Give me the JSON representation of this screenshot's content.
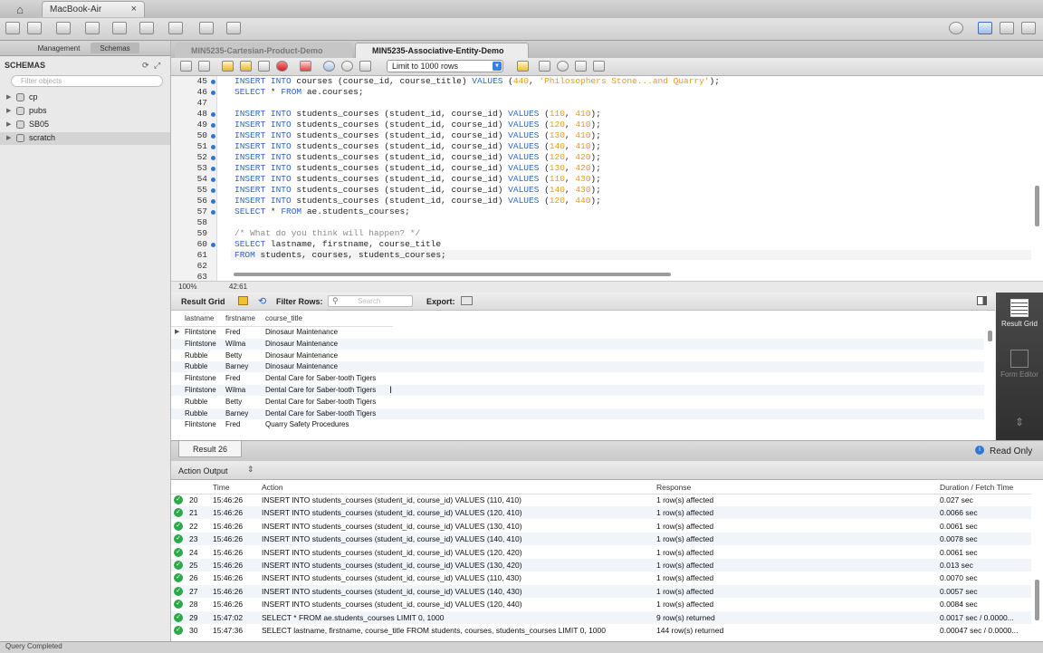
{
  "window": {
    "connection_tab": "MacBook-Air",
    "close_glyph": "×"
  },
  "sidebar": {
    "tabs": [
      "Management",
      "Schemas"
    ],
    "header": "SCHEMAS",
    "filter_placeholder": "Filter objects",
    "schemas": [
      "cp",
      "pubs",
      "SB05",
      "scratch"
    ]
  },
  "doc_tabs": [
    {
      "label": "MIN5235-Cartesian-Product-Demo",
      "active": false
    },
    {
      "label": "MIN5235-Associative-Entity-Demo",
      "active": true
    }
  ],
  "editor_toolbar": {
    "limit": "Limit to 1000 rows"
  },
  "editor": {
    "lines": [
      {
        "n": "45",
        "dot": true
      },
      {
        "n": "46",
        "dot": true
      },
      {
        "n": "47",
        "dot": false
      },
      {
        "n": "48",
        "dot": true
      },
      {
        "n": "49",
        "dot": true
      },
      {
        "n": "50",
        "dot": true
      },
      {
        "n": "51",
        "dot": true
      },
      {
        "n": "52",
        "dot": true
      },
      {
        "n": "53",
        "dot": true
      },
      {
        "n": "54",
        "dot": true
      },
      {
        "n": "55",
        "dot": true
      },
      {
        "n": "56",
        "dot": true
      },
      {
        "n": "57",
        "dot": true
      },
      {
        "n": "58",
        "dot": false
      },
      {
        "n": "59",
        "dot": false
      },
      {
        "n": "60",
        "dot": true
      },
      {
        "n": "61",
        "dot": false
      },
      {
        "n": "62",
        "dot": false
      },
      {
        "n": "63",
        "dot": false
      }
    ],
    "code": {
      "l45_a": "INSERT INTO",
      "l45_b": " courses (course_id, course_title) ",
      "l45_c": "VALUES",
      "l45_d": " (",
      "l45_e": "440",
      "l45_f": ", ",
      "l45_g": "'Philosophers Stone...and Quarry'",
      "l45_h": ");",
      "l46_a": "SELECT",
      "l46_b": " * ",
      "l46_c": "FROM",
      "l46_d": " ae.courses;",
      "ins_kw": "INSERT INTO",
      "ins_mid": " students_courses (student_id, course_id) ",
      "ins_vals": "VALUES",
      "inserts": [
        [
          "110",
          "410"
        ],
        [
          "120",
          "410"
        ],
        [
          "130",
          "410"
        ],
        [
          "140",
          "410"
        ],
        [
          "120",
          "420"
        ],
        [
          "130",
          "420"
        ],
        [
          "110",
          "430"
        ],
        [
          "140",
          "430"
        ],
        [
          "120",
          "440"
        ]
      ],
      "l57_a": "SELECT",
      "l57_b": " * ",
      "l57_c": "FROM",
      "l57_d": " ae.students_courses;",
      "l59": "/* What do you think will happen? */",
      "l60_a": "SELECT",
      "l60_b": " lastname, firstname, course_title",
      "l61_a": "FROM",
      "l61_b": " students, courses, students_courses;"
    },
    "status": {
      "zoom": "100%",
      "cursor": "42:61"
    }
  },
  "result_toolbar": {
    "result_grid": "Result Grid",
    "filter_rows": "Filter Rows:",
    "search_placeholder": "Search",
    "export": "Export:"
  },
  "result_grid": {
    "columns": [
      "lastname",
      "firstname",
      "course_title"
    ],
    "rows": [
      [
        "Flintstone",
        "Fred",
        "Dinosaur Maintenance"
      ],
      [
        "Flintstone",
        "Wilma",
        "Dinosaur Maintenance"
      ],
      [
        "Rubble",
        "Betty",
        "Dinosaur Maintenance"
      ],
      [
        "Rubble",
        "Barney",
        "Dinosaur Maintenance"
      ],
      [
        "Flintstone",
        "Fred",
        "Dental Care for Saber-tooth Tigers"
      ],
      [
        "Flintstone",
        "Wilma",
        "Dental Care for Saber-tooth Tigers"
      ],
      [
        "Rubble",
        "Betty",
        "Dental Care for Saber-tooth Tigers"
      ],
      [
        "Rubble",
        "Barney",
        "Dental Care for Saber-tooth Tigers"
      ],
      [
        "Flintstone",
        "Fred",
        "Quarry Safety Procedures"
      ]
    ]
  },
  "result_side": {
    "result_grid": "Result Grid",
    "form_editor": "Form Editor"
  },
  "result_footer": {
    "tab": "Result 26",
    "read_only": "Read Only"
  },
  "action_output": {
    "title": "Action Output",
    "columns": [
      "Time",
      "Action",
      "Response",
      "Duration / Fetch Time"
    ],
    "rows": [
      [
        "20",
        "15:46:26",
        "INSERT INTO students_courses (student_id, course_id) VALUES (110, 410)",
        "1 row(s) affected",
        "0.027 sec"
      ],
      [
        "21",
        "15:46:26",
        "INSERT INTO students_courses (student_id, course_id) VALUES (120, 410)",
        "1 row(s) affected",
        "0.0066 sec"
      ],
      [
        "22",
        "15:46:26",
        "INSERT INTO students_courses (student_id, course_id) VALUES (130, 410)",
        "1 row(s) affected",
        "0.0061 sec"
      ],
      [
        "23",
        "15:46:26",
        "INSERT INTO students_courses (student_id, course_id) VALUES (140, 410)",
        "1 row(s) affected",
        "0.0078 sec"
      ],
      [
        "24",
        "15:46:26",
        "INSERT INTO students_courses (student_id, course_id) VALUES (120, 420)",
        "1 row(s) affected",
        "0.0061 sec"
      ],
      [
        "25",
        "15:46:26",
        "INSERT INTO students_courses (student_id, course_id) VALUES (130, 420)",
        "1 row(s) affected",
        "0.013 sec"
      ],
      [
        "26",
        "15:46:26",
        "INSERT INTO students_courses (student_id, course_id) VALUES (110, 430)",
        "1 row(s) affected",
        "0.0070 sec"
      ],
      [
        "27",
        "15:46:26",
        "INSERT INTO students_courses (student_id, course_id) VALUES (140, 430)",
        "1 row(s) affected",
        "0.0057 sec"
      ],
      [
        "28",
        "15:46:26",
        "INSERT INTO students_courses (student_id, course_id) VALUES (120, 440)",
        "1 row(s) affected",
        "0.0084 sec"
      ],
      [
        "29",
        "15:47:02",
        "SELECT * FROM ae.students_courses LIMIT 0, 1000",
        "9 row(s) returned",
        "0.0017 sec / 0.0000..."
      ],
      [
        "30",
        "15:47:36",
        "SELECT lastname, firstname, course_title FROM students, courses, students_courses LIMIT 0, 1000",
        "144 row(s) returned",
        "0.00047 sec / 0.0000..."
      ]
    ]
  },
  "statusbar": {
    "text": "Query Completed"
  },
  "colors": {
    "keyword": "#2f64c6",
    "number": "#e39a19",
    "comment": "#8a8a8a",
    "success": "#2da84a",
    "accent": "#2f78d0"
  }
}
